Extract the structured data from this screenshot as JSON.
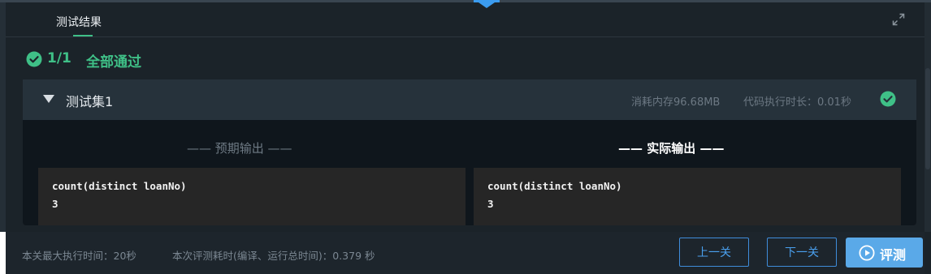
{
  "header": {
    "tab_label": "测试结果",
    "expand_icon": "expand-icon"
  },
  "summary": {
    "count": "1/1",
    "status": "全部通过",
    "color": "#3fc087"
  },
  "test_set": {
    "name": "测试集1",
    "memory": "消耗内存96.68MB",
    "duration": "代码执行时长：0.01秒",
    "passed": true
  },
  "compare": {
    "expected_title": "—— 预期输出 ——",
    "actual_title": "—— 实际输出 ——",
    "expected_lines": [
      "count(distinct loanNo)",
      "3"
    ],
    "actual_lines": [
      "count(distinct loanNo)",
      "3"
    ]
  },
  "footer": {
    "max_time": "本关最大执行时间：20秒",
    "eval_time": "本次评测耗时(编译、运行总时间)：0.379 秒",
    "prev_label": "上一关",
    "next_label": "下一关",
    "eval_label": "评测"
  },
  "colors": {
    "accent": "#3fc087",
    "button_blue": "#4aa0ee",
    "panel_bg": "#1b2329"
  }
}
